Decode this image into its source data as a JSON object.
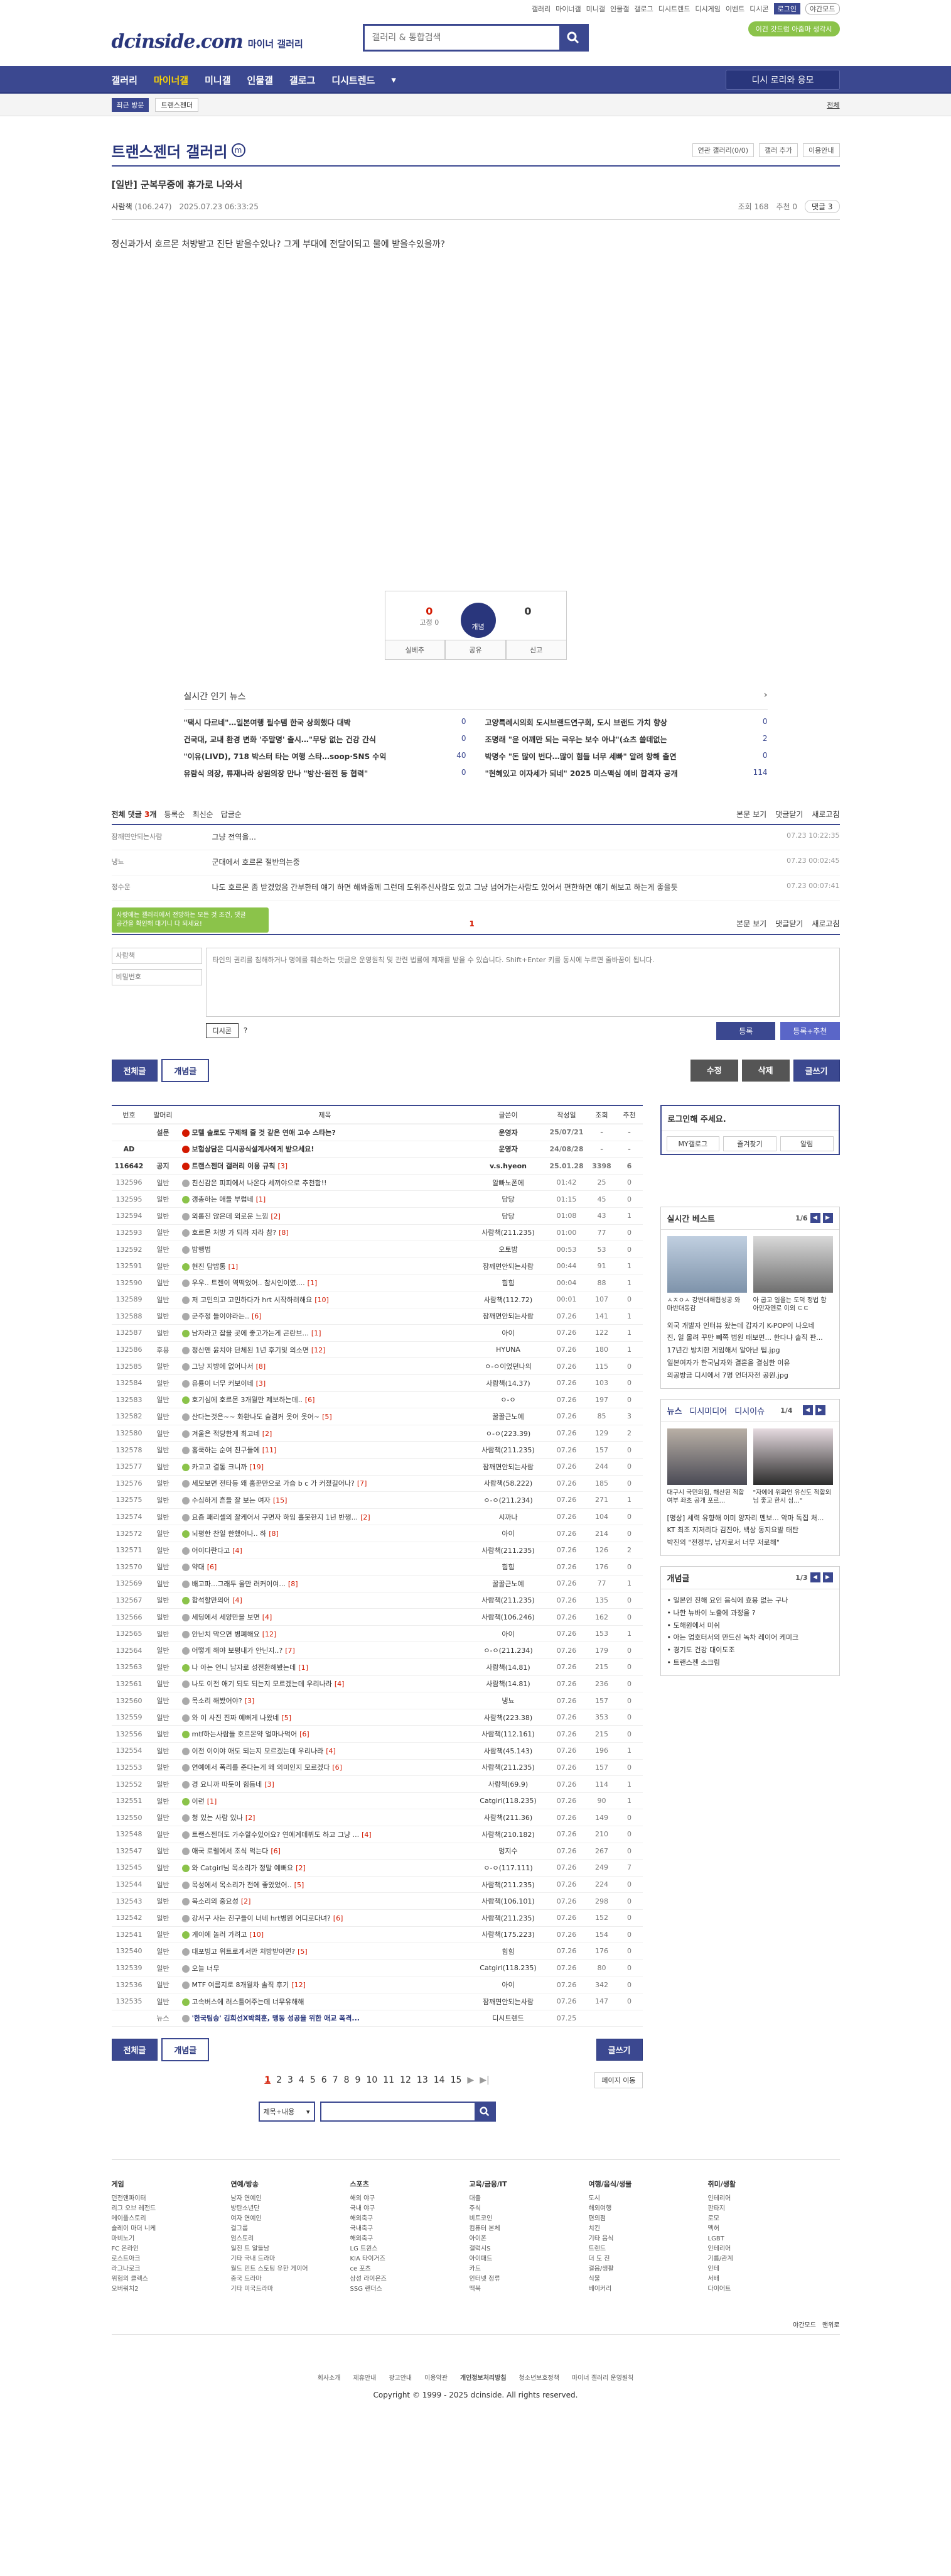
{
  "util": {
    "links": [
      "갤러리",
      "마이너갤",
      "미니갤",
      "인물갤",
      "갤로그",
      "디시트렌드",
      "디시게임",
      "이벤트",
      "디시콘"
    ],
    "login": "로그인",
    "night": "야간모드"
  },
  "header": {
    "logo": "dcinside.com",
    "sub": "마이너 갤러리",
    "search_placeholder": "갤러리 & 통합검색",
    "green_badge": "이건 갓드럼 아줌마 생각시"
  },
  "gnb": {
    "items": [
      "갤러리",
      "마이너갤",
      "미니갤",
      "인물갤",
      "갤로그",
      "디시트렌드"
    ],
    "ask": "디시 로리와 응모"
  },
  "visit": {
    "tag": "최근 방문",
    "chip": "트랜스젠더",
    "edit": "전체"
  },
  "gallery": {
    "name": "트랜스젠더 갤러리",
    "mark": "m",
    "opts": [
      "연관 갤러리(0/0)",
      "갤러 추가",
      "이용안내"
    ]
  },
  "post": {
    "title": "[일반] 군복무중에 휴가로 나와서",
    "writer": "사람책",
    "ip": "(106.247)",
    "date": "2025.07.23 06:33:25",
    "views": "조회 168",
    "rec": "추천 0",
    "comments": "댓글 3",
    "body": "정신과가서 호르몬 처방받고 진단 받을수있나? 그게 부대에 전달이되고 물에 받을수있을까?"
  },
  "recommend": {
    "up": "0",
    "fixed": "고정 0",
    "down": "0",
    "btn": "개념",
    "actions": [
      "실베추",
      "공유",
      "신고"
    ]
  },
  "news": {
    "title": "실시간 인기 뉴스",
    "items": [
      {
        "t": "\"택시 다르네\"…일본여행 필수템 한국 상회했다 대박",
        "c": "0"
      },
      {
        "t": "고양특례시의회 도시브랜드연구회, 도시 브랜드 가치 향상",
        "c": "0"
      },
      {
        "t": "건국대, 교내 환경 변화 '주말명' 출시…\"무당 없는 건강 간식",
        "c": "0"
      },
      {
        "t": "조명래 \"윤 어깨만 되는 극우는 보수 아냐\"(쇼츠 쓸데없는",
        "c": "2"
      },
      {
        "t": "\"이유(LIVD), 718 박스터 타는 여행 스타…soop·SNS 수익",
        "c": "40"
      },
      {
        "t": "박명수 \"돈 많이 번다…많이 힘들 너무 세빠\" 알려 항해 출연",
        "c": "0"
      },
      {
        "t": "유람식 의장, 류재나라 상원의장 만나 \"방산·원전 등 협력\"",
        "c": "0"
      },
      {
        "t": "\"현혜있고 이자세가 되네\" 2025 미스맥심 예비 합격자 공개",
        "c": "114"
      }
    ]
  },
  "comment_bar": {
    "all": "전체 댓글",
    "count": "3",
    "unit": "개",
    "sort1": "등록순",
    "sort2": "최신순",
    "sort3": "답글순",
    "view": "본문 보기",
    "fold": "댓글닫기",
    "refresh": "새로고침"
  },
  "comments": [
    {
      "nick": "잠깨면안되는사람",
      "text": "그냥 전역을...",
      "date": "07.23 10:22:35"
    },
    {
      "nick": "냉뇨",
      "text": "군대에서 호르몬 절반의는중",
      "date": "07.23 00:02:45"
    },
    {
      "nick": "정수운",
      "text": "나도 호르몬 좀 받겠었음 간부한테 얘기 하면 해봐줄께 그런데 도위주신사람도 있고 그냥 넘어가는사람도 있어서 편한하면 얘기 해보고 하는게 좋을듯",
      "date": "07.23 00:07:41"
    }
  ],
  "comment_pager": {
    "page": "1",
    "tip": "사랑에는 갤러리에서 전망하는 모든 것 조건, 댓글 공간을 확인해 대기니 다 되세요!"
  },
  "form": {
    "nick_placeholder": "사람책",
    "pw_placeholder": "비밀번호",
    "text_placeholder": "타인의 권리를 침해하거나 명예를 훼손하는 댓글은 운영원칙 및 관련 법률에 제재를 받을 수 있습니다. Shift+Enter 키를 동시에 누르면 줄바꿈이 됩니다.",
    "dccon": "디시콘",
    "reg": "등록",
    "regrec": "등록+추천"
  },
  "btns": {
    "all": "전체글",
    "rec": "개념글",
    "edit": "수정",
    "del": "삭제",
    "write": "글쓰기"
  },
  "list": {
    "headers": [
      "번호",
      "말머리",
      "제목",
      "글쓴이",
      "작성일",
      "조회",
      "추천"
    ],
    "rows": [
      {
        "n": "",
        "h": "설문",
        "t": "모텔 솔로도 구제해 줄 것 같은 연애 고수 스타는?",
        "w": "운영자",
        "d": "25/07/21",
        "v": "-",
        "r": "-",
        "notice": true
      },
      {
        "n": "AD",
        "h": "",
        "t": "보험상담은 디시공식설계사에게 받으세요!",
        "w": "운영자",
        "d": "24/08/28",
        "v": "-",
        "r": "-",
        "notice": true
      },
      {
        "n": "116642",
        "h": "공지",
        "t": "트랜스젠더 갤러리 이용 규칙",
        "c": "3",
        "w": "v.s.hyeon",
        "d": "25.01.28",
        "v": "3398",
        "r": "6",
        "notice": true
      },
      {
        "n": "132596",
        "h": "일반",
        "t": "친신감은 피피에서 나온다 세끼야으로 추천함!!",
        "w": "알빠노폰에",
        "d": "01:42",
        "v": "25",
        "r": "0"
      },
      {
        "n": "132595",
        "h": "일반",
        "t": "갱총하는 애들 부럽네",
        "c": "1",
        "w": "담당",
        "d": "01:15",
        "v": "45",
        "r": "0"
      },
      {
        "n": "132594",
        "h": "일반",
        "t": "외롭진 않은데 외로운 느낌",
        "c": "2",
        "w": "담당",
        "d": "01:08",
        "v": "43",
        "r": "1"
      },
      {
        "n": "132593",
        "h": "일반",
        "t": "호르몬 처방 가 되라 자라 참?",
        "c": "8",
        "w": "사람책(211.235)",
        "d": "01:00",
        "v": "77",
        "r": "0"
      },
      {
        "n": "132592",
        "h": "일반",
        "t": "밤행법",
        "w": "오토밤",
        "d": "00:53",
        "v": "53",
        "r": "0"
      },
      {
        "n": "132591",
        "h": "일반",
        "t": "현진 담밥통",
        "c": "1",
        "w": "잠깨면안되는사람",
        "d": "00:44",
        "v": "91",
        "r": "1"
      },
      {
        "n": "132590",
        "h": "일반",
        "t": "우우.. 트젠이 역떡었어.. 참시인이였....",
        "c": "1",
        "w": "힘힘",
        "d": "00:04",
        "v": "88",
        "r": "1"
      },
      {
        "n": "132589",
        "h": "일반",
        "t": "저 고민의고 고민하다가 hrt 시작하려해요",
        "c": "10",
        "w": "사람책(112.72)",
        "d": "00:01",
        "v": "107",
        "r": "0"
      },
      {
        "n": "132588",
        "h": "일반",
        "t": "군주정 들이야라는..",
        "c": "6",
        "w": "잠깨면안되는사람",
        "d": "07.26",
        "v": "141",
        "r": "1"
      },
      {
        "n": "132587",
        "h": "일반",
        "t": "남자라고 잡을 곳에 좋고가는게 곤란브...",
        "c": "1",
        "w": "아이",
        "d": "07.26",
        "v": "122",
        "r": "1"
      },
      {
        "n": "132586",
        "h": "후용",
        "t": "정산맨 윤치야 단체된 1년 후기및 의소면",
        "c": "12",
        "w": "HYUNA",
        "d": "07.26",
        "v": "180",
        "r": "1"
      },
      {
        "n": "132585",
        "h": "일반",
        "t": "그냥 지방에 없어나서",
        "c": "8",
        "w": "ㅇ-ㅇ이었던나의",
        "d": "07.26",
        "v": "115",
        "r": "0"
      },
      {
        "n": "132584",
        "h": "일반",
        "t": "유룡이 너무 커보이네",
        "c": "3",
        "w": "사람책(14.37)",
        "d": "07.26",
        "v": "103",
        "r": "0"
      },
      {
        "n": "132583",
        "h": "일반",
        "t": "호기심에 호르몬 3개월만 제보하는데..",
        "c": "6",
        "w": "ㅇ-ㅇ",
        "d": "07.26",
        "v": "197",
        "r": "0"
      },
      {
        "n": "132582",
        "h": "일반",
        "t": "산다는것은~~ 화환나도 슬겸커 웃어 웃어~",
        "c": "5",
        "w": "꿀꿀근노예",
        "d": "07.26",
        "v": "85",
        "r": "3"
      },
      {
        "n": "132580",
        "h": "일반",
        "t": "겨울은 적당한게 최고네",
        "c": "2",
        "w": "ㅇ-ㅇ(223.39)",
        "d": "07.26",
        "v": "129",
        "r": "2"
      },
      {
        "n": "132578",
        "h": "일반",
        "t": "홈쿡하는 순여 친구들에",
        "c": "11",
        "w": "사람책(211.235)",
        "d": "07.26",
        "v": "157",
        "r": "0"
      },
      {
        "n": "132577",
        "h": "일반",
        "t": "카고고 결통 크니까",
        "c": "19",
        "w": "잠깨면안되는사람",
        "d": "07.26",
        "v": "244",
        "r": "0"
      },
      {
        "n": "132576",
        "h": "일반",
        "t": "세모보면 전타등 왜 홈꾼만으로 가습 b c 가 커졌길어나?",
        "c": "7",
        "w": "사람책(58.222)",
        "d": "07.26",
        "v": "185",
        "r": "0"
      },
      {
        "n": "132575",
        "h": "일반",
        "t": "수심하게 흔들 잘 보는 여자",
        "c": "15",
        "w": "ㅇ-ㅇ(211.234)",
        "d": "07.26",
        "v": "271",
        "r": "1"
      },
      {
        "n": "132574",
        "h": "일반",
        "t": "요즘 패리셀의 잘케어서 구면자 하임 홀못한지 1년 반쩡...",
        "c": "2",
        "w": "시까나",
        "d": "07.26",
        "v": "104",
        "r": "0"
      },
      {
        "n": "132572",
        "h": "일반",
        "t": "뇌평한 찬일 한했어나.. 하",
        "c": "8",
        "w": "아이",
        "d": "07.26",
        "v": "214",
        "r": "0"
      },
      {
        "n": "132571",
        "h": "일반",
        "t": "어이다란다고",
        "c": "4",
        "w": "사람책(211.235)",
        "d": "07.26",
        "v": "126",
        "r": "2"
      },
      {
        "n": "132570",
        "h": "일반",
        "t": "약대",
        "c": "6",
        "w": "힘힘",
        "d": "07.26",
        "v": "176",
        "r": "0"
      },
      {
        "n": "132569",
        "h": "일반",
        "t": "배고파...그래두 올만 러커이여...",
        "c": "8",
        "w": "꿀꿀근노예",
        "d": "07.26",
        "v": "77",
        "r": "1"
      },
      {
        "n": "132567",
        "h": "일반",
        "t": "합석할만의어",
        "c": "4",
        "w": "사람책(211.235)",
        "d": "07.26",
        "v": "135",
        "r": "0"
      },
      {
        "n": "132566",
        "h": "일반",
        "t": "세딩에서 세양만을 보면",
        "c": "4",
        "w": "사람책(106.246)",
        "d": "07.26",
        "v": "162",
        "r": "0"
      },
      {
        "n": "132565",
        "h": "일반",
        "t": "안난치 막으면 병폐해요",
        "c": "12",
        "w": "아이",
        "d": "07.26",
        "v": "153",
        "r": "1"
      },
      {
        "n": "132564",
        "h": "일반",
        "t": "어떻게 해야 보평내가 안닌지..?",
        "c": "7",
        "w": "ㅇ-ㅇ(211.234)",
        "d": "07.26",
        "v": "179",
        "r": "0"
      },
      {
        "n": "132563",
        "h": "일반",
        "t": "나 아는 언니 남자로 성전환해봤는데",
        "c": "1",
        "w": "사람책(14.81)",
        "d": "07.26",
        "v": "215",
        "r": "0"
      },
      {
        "n": "132561",
        "h": "일반",
        "t": "나도 이전 애기 되도 되는지 모르겠는데 우리나라",
        "c": "4",
        "w": "사람책(14.81)",
        "d": "07.26",
        "v": "236",
        "r": "0"
      },
      {
        "n": "132560",
        "h": "일반",
        "t": "목소리 해봤어야?",
        "c": "3",
        "w": "냉뇨",
        "d": "07.26",
        "v": "157",
        "r": "0"
      },
      {
        "n": "132559",
        "h": "일반",
        "t": "와 이 사진 진짜 예뻐게 나왔네",
        "c": "5",
        "w": "사람책(223.38)",
        "d": "07.26",
        "v": "353",
        "r": "0"
      },
      {
        "n": "132556",
        "h": "일반",
        "t": "mtf하는사람들 호르몬약 얼마나먹어",
        "c": "6",
        "w": "사람책(112.161)",
        "d": "07.26",
        "v": "215",
        "r": "0"
      },
      {
        "n": "132554",
        "h": "일반",
        "t": "이전 이이야 애도 되는지 모르겠는데 우리나라",
        "c": "4",
        "w": "사람책(45.143)",
        "d": "07.26",
        "v": "196",
        "r": "1"
      },
      {
        "n": "132553",
        "h": "일반",
        "t": "연예에서 폭리를 준다는게 왜 의미인지 모르겠다",
        "c": "6",
        "w": "사람책(211.235)",
        "d": "07.26",
        "v": "157",
        "r": "0"
      },
      {
        "n": "132552",
        "h": "일반",
        "t": "경 요니까 따듯이 힘듬네",
        "c": "3",
        "w": "사람책(69.9)",
        "d": "07.26",
        "v": "114",
        "r": "1"
      },
      {
        "n": "132551",
        "h": "일반",
        "t": "이런",
        "c": "1",
        "w": "Catgirl(118.235)",
        "d": "07.26",
        "v": "90",
        "r": "1"
      },
      {
        "n": "132550",
        "h": "일반",
        "t": "청 있는 사람 있나",
        "c": "2",
        "w": "사람책(211.36)",
        "d": "07.26",
        "v": "149",
        "r": "0"
      },
      {
        "n": "132548",
        "h": "일반",
        "t": "트랜스젠더도 가수할수있어요? 연예계데뷔도 하고 그냥 ...",
        "c": "4",
        "w": "사람책(210.182)",
        "d": "07.26",
        "v": "210",
        "r": "0"
      },
      {
        "n": "132547",
        "h": "일반",
        "t": "애국 로렐에서 조식 먹는다",
        "c": "6",
        "w": "멍지수",
        "d": "07.26",
        "v": "267",
        "r": "0"
      },
      {
        "n": "132545",
        "h": "일반",
        "t": "와 Catgirl님 목소리가 정말 예뻐요",
        "c": "2",
        "w": "ㅇ-ㅇ(117.111)",
        "d": "07.26",
        "v": "249",
        "r": "7"
      },
      {
        "n": "132544",
        "h": "일반",
        "t": "목성에서 목소리가 전에 좋았었어..",
        "c": "5",
        "w": "사람책(211.235)",
        "d": "07.26",
        "v": "224",
        "r": "0"
      },
      {
        "n": "132543",
        "h": "일반",
        "t": "목소리의 중요성",
        "c": "2",
        "w": "사람책(106.101)",
        "d": "07.26",
        "v": "298",
        "r": "0"
      },
      {
        "n": "132542",
        "h": "일반",
        "t": "강서구 사는 친구들이 너네 hrt병원 어디로다녀?",
        "c": "6",
        "w": "사람책(211.235)",
        "d": "07.26",
        "v": "152",
        "r": "0"
      },
      {
        "n": "132541",
        "h": "일반",
        "t": "게이에 놀러 가려고",
        "c": "10",
        "w": "사람책(175.223)",
        "d": "07.26",
        "v": "154",
        "r": "0"
      },
      {
        "n": "132540",
        "h": "일반",
        "t": "대포빙고 위트로게서만 처방받아면?",
        "c": "5",
        "w": "힘힘",
        "d": "07.26",
        "v": "176",
        "r": "0"
      },
      {
        "n": "132539",
        "h": "일반",
        "t": "오늘 너무",
        "w": "Catgirl(118.235)",
        "d": "07.26",
        "v": "80",
        "r": "0"
      },
      {
        "n": "132536",
        "h": "일반",
        "t": "MTF 여름지로 8개월차 솔직 후기",
        "c": "12",
        "w": "아이",
        "d": "07.26",
        "v": "342",
        "r": "0"
      },
      {
        "n": "132535",
        "h": "일반",
        "t": "고속버스에 러스틀어주는데 너무유해해",
        "w": "잠깨면안되는사람",
        "d": "07.26",
        "v": "147",
        "r": "0"
      },
      {
        "n": "",
        "h": "뉴스",
        "t": "'한국팀승' 김희선X박희훈, 맹동 성공을 위한 애교 폭격...",
        "w": "디시트렌드",
        "d": "07.25",
        "v": "",
        "r": "",
        "news": true
      }
    ]
  },
  "pagination": {
    "pages": [
      "1",
      "2",
      "3",
      "4",
      "5",
      "6",
      "7",
      "8",
      "9",
      "10",
      "11",
      "12",
      "13",
      "14",
      "15"
    ],
    "move": "페이지 이동"
  },
  "bsearch": {
    "select": "제목+내용"
  },
  "side": {
    "login": {
      "title": "로그인해 주세요.",
      "btns": [
        "MY갤로그",
        "즐겨찾기",
        "알림"
      ]
    },
    "best": {
      "title": "실시간 베스트",
      "page": "1/6",
      "caps": [
        "ㅅㅈㅇㅅ 강변대해협성공 와 마반대동감",
        "아 굽고 일을는 도덕 정법 함 아만자엔로 이외 ㄷㄷ"
      ],
      "list": [
        "외국 개발자 인터뷰 왔는데 갑자기 K-POP이 나오네",
        "진, 일 몰려 꾸만 빼쪽 법원 태보면... 한다냐 솔직 판...",
        "17년간 방치한 게임해서 알아난 팁.jpg",
        "일본여자가 한국남자와 결혼을 결심한 이유",
        "의공방금 디시에서 7명 언더자전 공원.jpg"
      ]
    },
    "news": {
      "tabs": [
        "뉴스",
        "디시미디어",
        "디시이슈"
      ],
      "page": "1/4",
      "caps": [
        "대구시 국민의힘, 해산된 적합여부 좌초 공개 포르...",
        "\"자에에 위화언 유신도 적합외님 좋고 한시 심...\""
      ],
      "list": [
        "[명상] 세력 유향해 이미 양자리 멘보... 악마 독집 처...",
        "KT 최조 지저리다 김진아, 백상 동지요발 태탄",
        "박진의 \"전정부, 남자로서 너무 저로해\""
      ]
    },
    "concept": {
      "title": "개념글",
      "page": "1/3",
      "list": [
        "일본인 진해 요인 음식에 효용 없는 구나",
        "나한 뉴바이 노출에 과정을 ?",
        "도해원에서 미쉬",
        "아는 업호터서의 만드신 녹차 레이어 케미크",
        "경기도 건강 대이도조",
        "트랜스젠 소크림"
      ]
    }
  },
  "footer": {
    "cols": [
      {
        "h": "게임",
        "items": [
          "던전앤파이터",
          "리그 오브 레전드",
          "메이플스토리",
          "슬레이 마더 니케",
          "마비노기",
          "FC 온라인",
          "로스트아크",
          "라그나로크",
          "위험의 클렉스",
          "오버워치2"
        ]
      },
      {
        "h": "연예/방송",
        "items": [
          "남자 연예인",
          "방탄소년단",
          "여자 연예인",
          "걸그룹",
          "엄스토리",
          "일진 트 알들남",
          "기타 국내 드라마",
          "월드 민트 스토팅 유한 게이어",
          "중국 드라마",
          "기타 미국드라마"
        ]
      },
      {
        "h": "스포츠",
        "items": [
          "해외 야구",
          "국내 야구",
          "해외축구",
          "국내축구",
          "해외축구",
          "LG 트윈스",
          "KIA 타이거즈",
          "ce 포츠",
          "삼성 라이온즈",
          "SSG 랜더스"
        ]
      },
      {
        "h": "교육/금융/IT",
        "items": [
          "대출",
          "주식",
          "비트코인",
          "컴퓨터 본체",
          "아이폰",
          "갤럭시S",
          "아이패드",
          "카드",
          "인터넷 정류",
          "맥북"
        ]
      },
      {
        "h": "여행/음식/생물",
        "items": [
          "도시",
          "해외여행",
          "편의점",
          "치킨",
          "기타 음식",
          "트렌드",
          "더 도 진",
          "걸음/생활",
          "식물",
          "베이커리"
        ]
      },
      {
        "h": "취미/생활",
        "items": [
          "인테리어",
          "판타지",
          "로모",
          "멕허",
          "LGBT",
          "인테리어",
          "기름/관계",
          "인테",
          "서배",
          "다이어트"
        ]
      }
    ],
    "small": [
      "야간모드",
      "맨위로"
    ],
    "links": [
      "회사소개",
      "제휴안내",
      "광고안내",
      "이용약관",
      "개인정보처리방침",
      "청소년보호정책",
      "마이너 갤러리 운영원칙"
    ],
    "copy": "Copyright © 1999 - 2025 dcinside. All rights reserved."
  }
}
